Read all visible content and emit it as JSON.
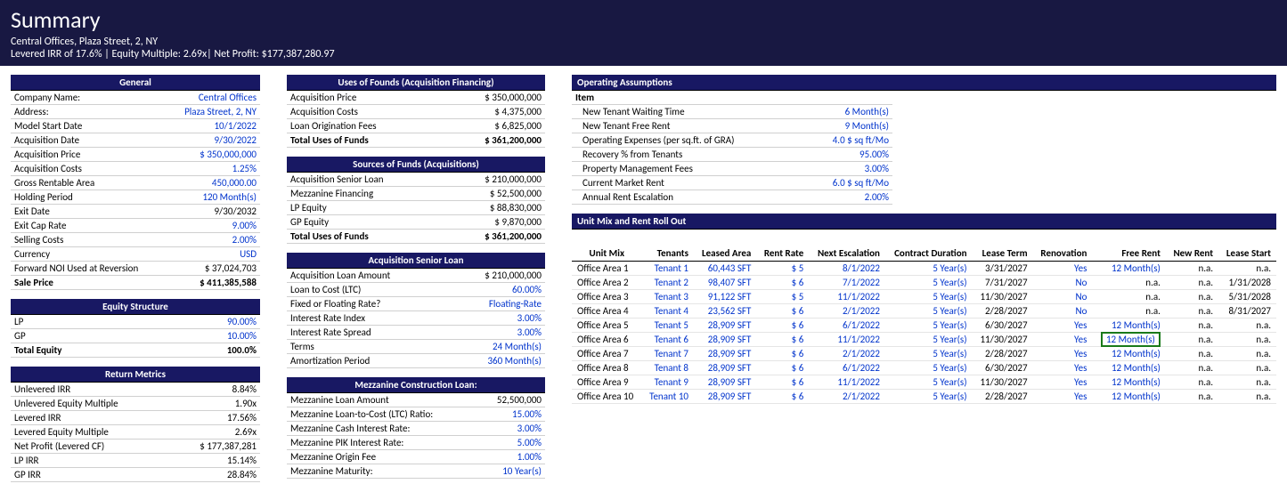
{
  "header": {
    "title": "Summary",
    "sub1": "Central Offices, Plaza Street, 2, NY",
    "sub2": "Levered IRR of 17.6% | Equity Multiple: 2.69x| Net Profit: $177,387,280.97"
  },
  "general": {
    "title": "General",
    "rows": [
      [
        "Company Name:",
        "Central Offices",
        true
      ],
      [
        "Address:",
        "Plaza Street, 2, NY",
        true
      ],
      [
        "Model Start Date",
        "10/1/2022",
        true
      ],
      [
        "Acquisition Date",
        "9/30/2022",
        true
      ],
      [
        "Acquisition Price",
        "$ 350,000,000",
        true
      ],
      [
        "Acquisition Costs",
        "1.25%",
        true
      ],
      [
        "Gross Rentable Area",
        "450,000.00",
        true
      ],
      [
        "Holding Period",
        "120 Month(s)",
        true
      ],
      [
        "Exit Date",
        "9/30/2032",
        false
      ],
      [
        "Exit Cap Rate",
        "9.00%",
        true
      ],
      [
        "Selling Costs",
        "2.00%",
        true
      ],
      [
        "Currency",
        "USD",
        true
      ],
      [
        "Forward NOI Used at Reversion",
        "$ 37,024,703",
        false
      ]
    ],
    "total": [
      "Sale Price",
      "$ 411,385,588"
    ]
  },
  "equity": {
    "title": "Equity Structure",
    "rows": [
      [
        "LP",
        "90.00%",
        true
      ],
      [
        "GP",
        "10.00%",
        true
      ]
    ],
    "total": [
      "Total Equity",
      "100.0%"
    ]
  },
  "returns": {
    "title": "Return Metrics",
    "rows": [
      [
        "Unlevered IRR",
        "8.84%"
      ],
      [
        "Unlevered Equity Multiple",
        "1.90x"
      ],
      [
        "Levered IRR",
        "17.56%"
      ],
      [
        "Levered Equity Multiple",
        "2.69x"
      ],
      [
        "Net Profit (Levered CF)",
        "$ 177,387,281"
      ],
      [
        "LP IRR",
        "15.14%"
      ],
      [
        "GP IRR",
        "28.84%"
      ]
    ]
  },
  "uses": {
    "title": "Uses of Founds  (Acquisition Financing)",
    "rows": [
      [
        "Acquisition Price",
        "$ 350,000,000"
      ],
      [
        "Acquisition Costs",
        "$ 4,375,000"
      ],
      [
        "Loan Origination Fees",
        "$ 6,825,000"
      ]
    ],
    "total": [
      "Total Uses of Funds",
      "$ 361,200,000"
    ]
  },
  "sources": {
    "title": "Sources of Funds (Acquisitions)",
    "rows": [
      [
        "Acquisition Senior Loan",
        "$ 210,000,000"
      ],
      [
        "Mezzanine Financing",
        "$ 52,500,000"
      ],
      [
        "LP Equity",
        "$ 88,830,000"
      ],
      [
        "GP Equity",
        "$ 9,870,000"
      ]
    ],
    "total": [
      "Total Uses of Funds",
      "$ 361,200,000"
    ]
  },
  "senior": {
    "title": "Acquisition Senior Loan",
    "rows": [
      [
        "Acquisition Loan Amount",
        "$ 210,000,000",
        false
      ],
      [
        "Loan to Cost (LTC)",
        "60.00%",
        true
      ],
      [
        "Fixed or Floating Rate?",
        "Floating-Rate",
        true
      ],
      [
        "Interest Rate Index",
        "3.00%",
        true
      ],
      [
        "Interest Rate Spread",
        "3.00%",
        true
      ],
      [
        "Terms",
        "24 Month(s)",
        true
      ],
      [
        "Amortization Period",
        "360 Month(s)",
        true
      ]
    ]
  },
  "mezz": {
    "title": "Mezzanine Construction Loan:",
    "rows": [
      [
        "Mezzanine Loan Amount",
        "52,500,000",
        false
      ],
      [
        "Mezzanine Loan-to-Cost (LTC) Ratio:",
        "15.00%",
        true
      ],
      [
        "Mezzanine Cash Interest Rate:",
        "3.00%",
        true
      ],
      [
        "Mezzanine PIK Interest Rate:",
        "5.00%",
        true
      ],
      [
        "Mezzanine Origin Fee",
        "1.00%",
        true
      ],
      [
        "Mezzanine Maturity:",
        "10 Year(s)",
        true
      ]
    ]
  },
  "opassump": {
    "title": "Operating Assumptions",
    "itemLabel": "Item",
    "rows": [
      [
        "New Tenant Waiting Time",
        "6 Month(s)"
      ],
      [
        "New Tenant Free Rent",
        "9 Month(s)"
      ],
      [
        "Operating Expenses (per sq.ft. of GRA)",
        "4.0 $ sq ft/Mo"
      ],
      [
        "Recovery % from Tenants",
        "95.00%"
      ],
      [
        "Property Management Fees",
        "3.00%"
      ],
      [
        "Current Market Rent",
        "6.0 $ sq ft/Mo"
      ],
      [
        "Annual Rent Escalation",
        "2.00%"
      ]
    ]
  },
  "unitmix": {
    "title": "Unit Mix and Rent Roll Out",
    "headers": [
      "Unit Mix",
      "Tenants",
      "Leased Area",
      "Rent Rate",
      "Next Escalation",
      "Contract Duration",
      "Lease Term",
      "Renovation",
      "Free Rent",
      "New Rent",
      "Lease Start"
    ],
    "rows": [
      [
        "Office Area 1",
        "Tenant 1",
        "60,443 SFT",
        "$ 5",
        "8/1/2022",
        "5 Year(s)",
        "3/31/2027",
        "Yes",
        "12 Month(s)",
        "n.a.",
        "n.a."
      ],
      [
        "Office Area 2",
        "Tenant 2",
        "98,407 SFT",
        "$ 6",
        "7/1/2022",
        "5 Year(s)",
        "7/31/2027",
        "No",
        "n.a.",
        "n.a.",
        "1/31/2028"
      ],
      [
        "Office Area 3",
        "Tenant 3",
        "91,122 SFT",
        "$ 5",
        "11/1/2022",
        "5 Year(s)",
        "11/30/2027",
        "No",
        "n.a.",
        "n.a.",
        "5/31/2028"
      ],
      [
        "Office Area 4",
        "Tenant 4",
        "23,562 SFT",
        "$ 6",
        "2/1/2022",
        "5 Year(s)",
        "2/28/2027",
        "No",
        "n.a.",
        "n.a.",
        "8/31/2027"
      ],
      [
        "Office Area 5",
        "Tenant 5",
        "28,909 SFT",
        "$ 6",
        "6/1/2022",
        "5 Year(s)",
        "6/30/2027",
        "Yes",
        "12 Month(s)",
        "n.a.",
        "n.a."
      ],
      [
        "Office Area 6",
        "Tenant 6",
        "28,909 SFT",
        "$ 6",
        "11/1/2022",
        "5 Year(s)",
        "11/30/2027",
        "Yes",
        "12 Month(s)",
        "n.a.",
        "n.a."
      ],
      [
        "Office Area 7",
        "Tenant 7",
        "28,909 SFT",
        "$ 6",
        "2/1/2022",
        "5 Year(s)",
        "2/28/2027",
        "Yes",
        "12 Month(s)",
        "n.a.",
        "n.a."
      ],
      [
        "Office Area 8",
        "Tenant 8",
        "28,909 SFT",
        "$ 6",
        "6/1/2022",
        "5 Year(s)",
        "6/30/2027",
        "Yes",
        "12 Month(s)",
        "n.a.",
        "n.a."
      ],
      [
        "Office Area 9",
        "Tenant 9",
        "28,909 SFT",
        "$ 6",
        "11/1/2022",
        "5 Year(s)",
        "11/30/2027",
        "Yes",
        "12 Month(s)",
        "n.a.",
        "n.a."
      ],
      [
        "Office Area 10",
        "Tenant 10",
        "28,909 SFT",
        "$ 6",
        "2/1/2022",
        "5 Year(s)",
        "2/28/2027",
        "Yes",
        "12 Month(s)",
        "n.a.",
        "n.a."
      ]
    ]
  }
}
